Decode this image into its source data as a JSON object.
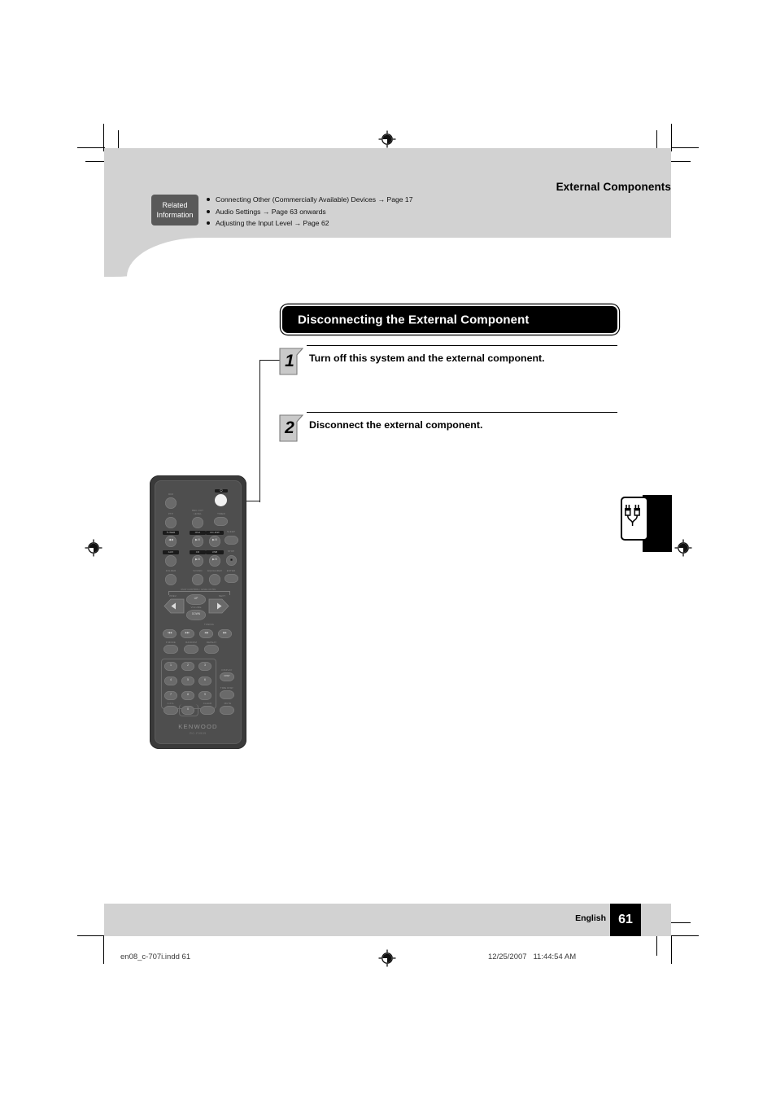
{
  "page": {
    "section_title": "External Components",
    "language": "English",
    "page_number": "61",
    "print_file": "en08_c-707i.indd   61",
    "print_date": "12/25/2007   11:44:54 AM"
  },
  "related": {
    "badge_line1": "Related",
    "badge_line2": "Information",
    "items": [
      "Connecting Other (Commercially Available) Devices → Page 17",
      "Audio Settings → Page 63 onwards",
      "Adjusting the Input Level → Page 62"
    ]
  },
  "heading": {
    "title": "Disconnecting the External Component"
  },
  "steps": [
    {
      "number": "1",
      "text": "Turn off this system and the external component."
    },
    {
      "number": "2",
      "text": "Disconnect the external component."
    }
  ],
  "side_tab": {
    "icon": "rca-plug-icon"
  },
  "remote": {
    "brand": "KENWOOD",
    "model": "RC-F0509",
    "power_glyph": "⏻",
    "buttons": {
      "dimmer": "DIM",
      "ptp": "PTP",
      "rec_out_level_l1": "REC OUT",
      "rec_out_level_l2": "LEVEL",
      "timer": "TIMER",
      "sleep": "SLEEP",
      "stop": "STOP",
      "enter": "ENTER",
      "tuner": "TUNER",
      "ipod": "iPod",
      "cdrw": "CD-R/W",
      "aux": "AUX",
      "cd": "CD",
      "usb": "USB",
      "folder": "FOLDER",
      "sound": "SOUND",
      "equalizer": "EQUALIZER",
      "multi_control": "MULTI CONTROL / LEVEL CNTRL",
      "prev": "PREV.",
      "next": "NEXT",
      "up": "UP",
      "volume": "VOLUME",
      "down": "DOWN",
      "tuning": "TUNING",
      "p_mode": "P.MODE",
      "random": "RANDOM",
      "repeat": "REPEAT",
      "apa": "A.P.A.",
      "clear": "CLEAR",
      "mute": "MUTE",
      "display": "DISPLAY",
      "display_glyph": "DISP",
      "time_disp": "TIME DISP."
    },
    "keypad": [
      "1",
      "2",
      "3",
      "4",
      "5",
      "6",
      "7",
      "8",
      "9",
      "0"
    ],
    "transport_glyphs": {
      "play_pause": "▶/II",
      "stop_square": "■",
      "rew": "I◀◀",
      "ffwd": "▶▶I",
      "skip_back": "◀◀",
      "skip_fwd": "▶▶",
      "left": "◀",
      "right": "▶"
    }
  }
}
